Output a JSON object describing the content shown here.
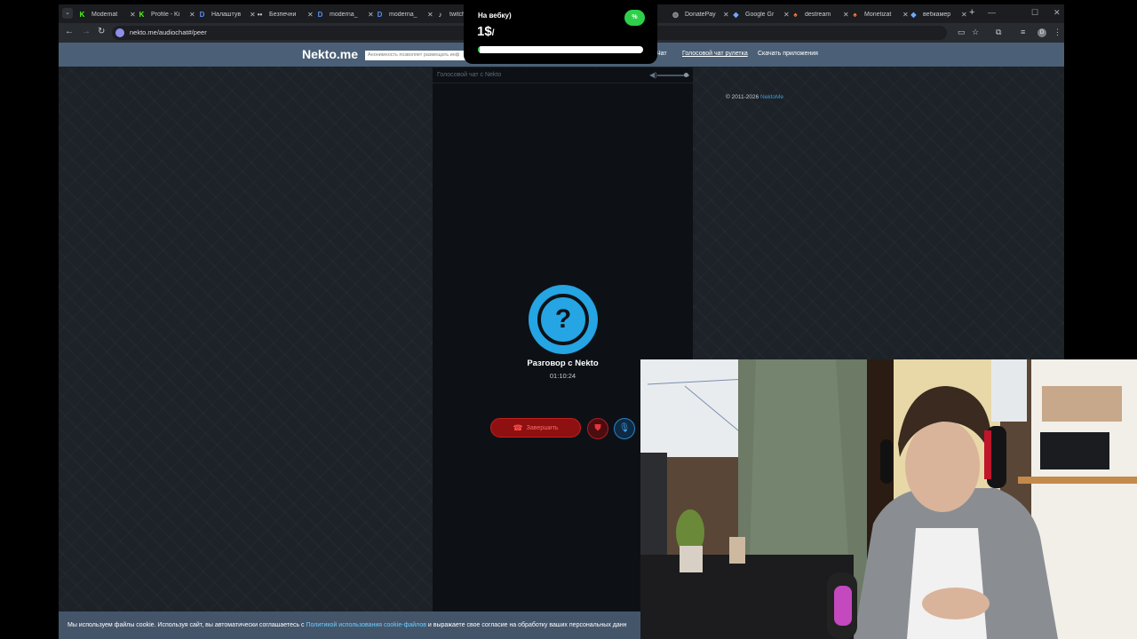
{
  "browser": {
    "tabs": [
      {
        "title": "Modemat",
        "icon": "kick-icon"
      },
      {
        "title": "Profile - Ki",
        "icon": "kick-icon"
      },
      {
        "title": "Налаштув",
        "icon": "d-icon"
      },
      {
        "title": "Безпечни",
        "icon": "dots-icon"
      },
      {
        "title": "moderna_",
        "icon": "d-icon"
      },
      {
        "title": "moderna_",
        "icon": "d-icon"
      },
      {
        "title": "twitch",
        "icon": "twitch-icon"
      },
      {
        "title": "DonatePay",
        "icon": "globe-icon"
      },
      {
        "title": "Google Gr",
        "icon": "google-icon"
      },
      {
        "title": "destream",
        "icon": "destream-icon"
      },
      {
        "title": "Monetizat",
        "icon": "destream-icon"
      },
      {
        "title": "вебкамер",
        "icon": "google-icon"
      }
    ],
    "url": "nekto.me/audiochat#/peer",
    "profile_initial": "D"
  },
  "site": {
    "logo": "Nekto.me",
    "anon_placeholder": "Анонимность позволяет размещать инф",
    "nav": [
      {
        "label": "Чат",
        "active": false
      },
      {
        "label": "Голосовой чат рулетка",
        "active": true
      },
      {
        "label": "Скачать приложения",
        "active": false
      }
    ]
  },
  "chat": {
    "header": "Голосовой чат с Nekto",
    "avatar_symbol": "?",
    "peer_name": "Разговор с Nekto",
    "timer": "01:10:24",
    "end_label": "Завершить",
    "volume_level": 0.9
  },
  "footer": {
    "copyright_prefix": "© 2011-2026",
    "copyright_link": "NektoMe"
  },
  "cookie": {
    "text_before": "Мы используем файлы cookie. Используя сайт, вы автоматически соглашаетесь с ",
    "link": "Политикой использования cookie-файлов",
    "text_after": " и выражаете свое согласие на обработку ваших персональных данн"
  },
  "donation": {
    "title": "На вебку)",
    "amount": "1$",
    "amount_suffix": "/",
    "percent_label": "%",
    "progress": 0.01,
    "accent": "#2ed04a"
  },
  "colors": {
    "site_nav": "#4b6077",
    "end_button": "#8e1010",
    "avatar": "#25a5e3",
    "link": "#3a9ad9"
  }
}
